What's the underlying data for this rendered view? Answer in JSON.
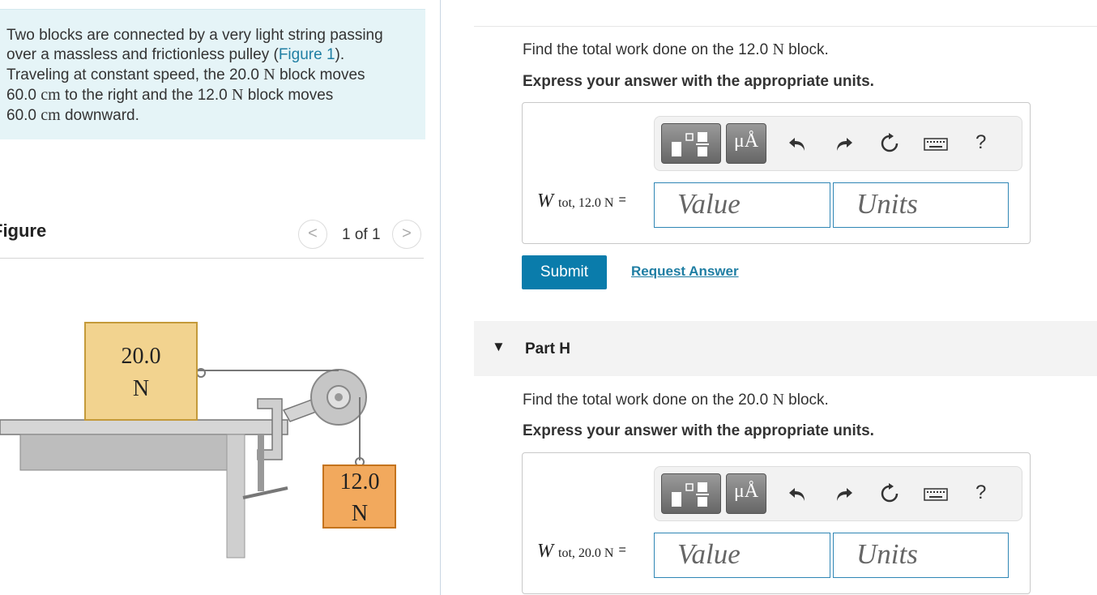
{
  "problem": {
    "line1": "Two blocks are connected by a very light string passing",
    "line2_pre": "over a massless and frictionless pulley (",
    "figure_link": "Figure 1",
    "line2_post": ").",
    "line3_pre": "Traveling at constant speed, the 20.0 ",
    "unit_N": "N",
    "line3_post": " block moves",
    "line4_num": "60.0 ",
    "unit_cm": "cm",
    "line4_post": " to the right and the 12.0 ",
    "line4_post2": " block moves",
    "line5_num": "60.0 ",
    "line5_post": " downward."
  },
  "figure": {
    "title": "Figure",
    "pager": "1 of 1",
    "prev_symbol": "<",
    "next_symbol": ">",
    "block1_value": "20.0",
    "block1_unit": "N",
    "block2_value": "12.0",
    "block2_unit": "N",
    "colors": {
      "block1": "#f2d38f",
      "block2": "#f2a95d",
      "table": "#c8c8c8"
    }
  },
  "part_g": {
    "question_pre": "Find the total work done on the 12.0 ",
    "question_unit": "N",
    "question_post": " block.",
    "instruction": "Express your answer with the appropriate units.",
    "var_symbol": "W",
    "var_subscript": "tot, 12.0 N",
    "equals": "=",
    "value_placeholder": "Value",
    "units_placeholder": "Units",
    "submit": "Submit",
    "request": "Request Answer"
  },
  "part_h": {
    "caret": "▼",
    "title": "Part H",
    "question_pre": "Find the total work done on the 20.0 ",
    "question_unit": "N",
    "question_post": " block.",
    "instruction": "Express your answer with the appropriate units.",
    "var_symbol": "W",
    "var_subscript": "tot, 20.0 N",
    "equals": "=",
    "value_placeholder": "Value",
    "units_placeholder": "Units"
  },
  "toolbar": {
    "mu_label": "μÅ",
    "help": "?",
    "icons": [
      "templates-icon",
      "units-icon",
      "undo-icon",
      "redo-icon",
      "reset-icon",
      "keyboard-icon",
      "help-icon"
    ]
  },
  "theme": {
    "accent": "#0a7cab",
    "link": "#1f7ea3",
    "problem_bg": "#e5f4f7"
  }
}
